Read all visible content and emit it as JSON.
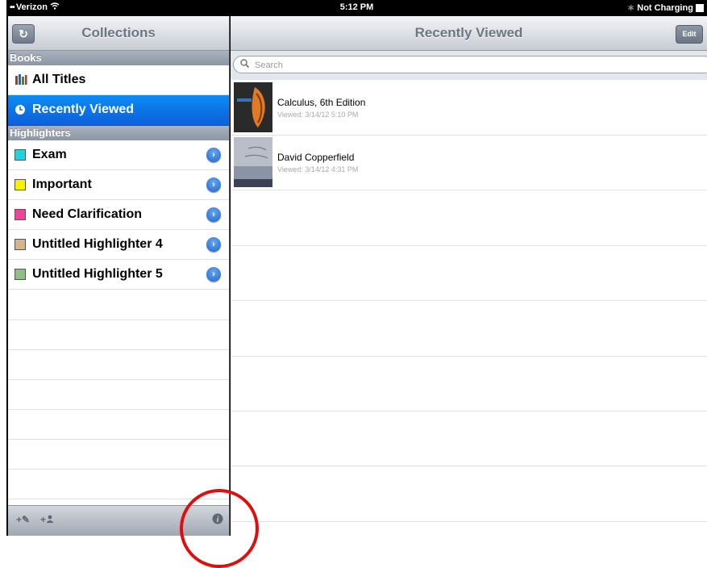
{
  "status_bar": {
    "carrier": "Verizon",
    "time": "5:12 PM",
    "charging": "Not Charging"
  },
  "sidebar": {
    "title": "Collections",
    "sections": {
      "books": "Books",
      "highlighters": "Highlighters"
    },
    "books": [
      {
        "label": "All Titles"
      },
      {
        "label": "Recently Viewed",
        "selected": true
      }
    ],
    "highlighters": [
      {
        "label": "Exam",
        "color": "#1fd3e0"
      },
      {
        "label": "Important",
        "color": "#f5f300"
      },
      {
        "label": "Need Clarification",
        "color": "#f0449c"
      },
      {
        "label": "Untitled Highlighter 4",
        "color": "#d8b48e"
      },
      {
        "label": "Untitled Highlighter 5",
        "color": "#8fbf86"
      }
    ]
  },
  "main": {
    "title": "Recently Viewed",
    "edit_label": "Edit",
    "search_placeholder": "Search",
    "books": [
      {
        "title": "Calculus,  6th Edition",
        "viewed": "Viewed: 3/14/12 5:10 PM"
      },
      {
        "title": "David Copperfield",
        "viewed": "Viewed: 3/14/12 4:31 PM"
      }
    ]
  },
  "colors": {
    "accent": "#0e6fe6",
    "annotation": "#e00d0d"
  }
}
